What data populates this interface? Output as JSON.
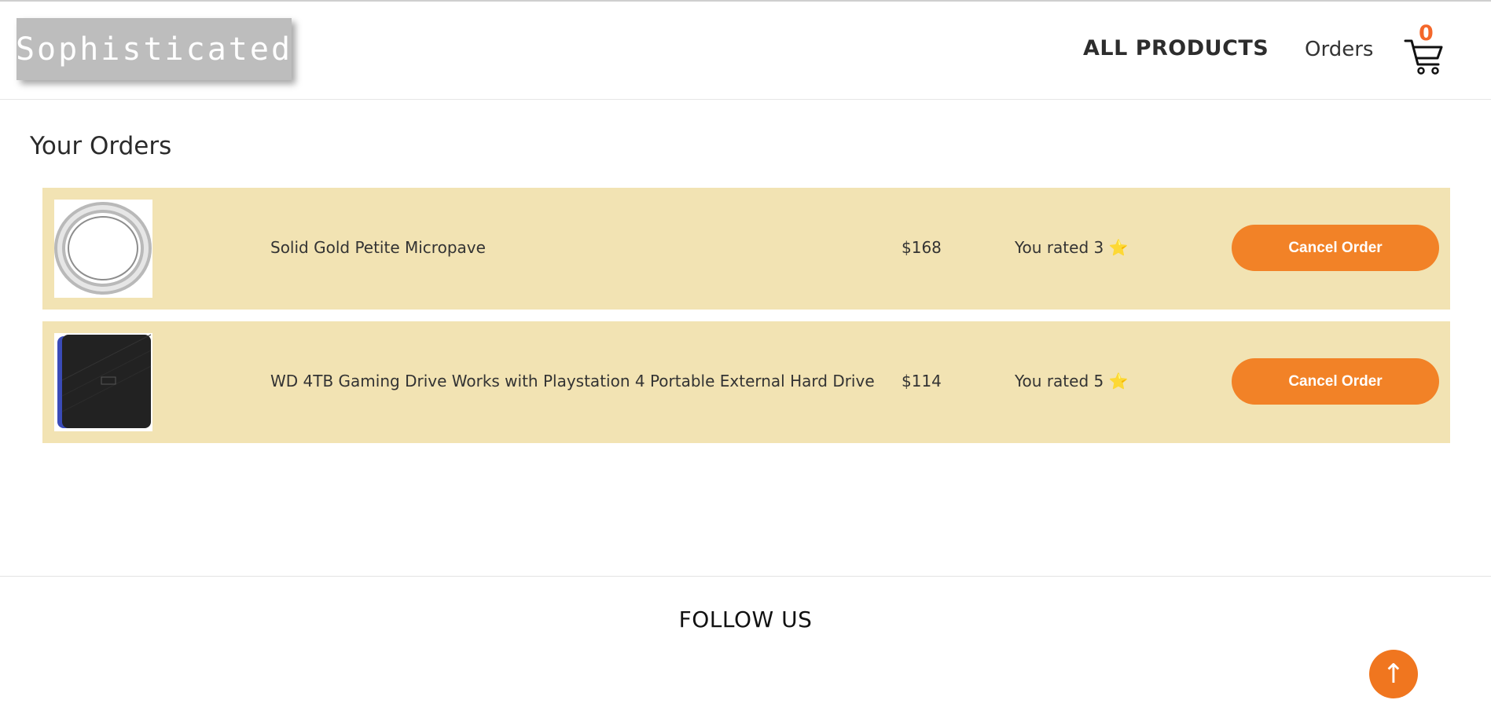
{
  "header": {
    "logo": "Sophisticated",
    "nav": {
      "all_products": "ALL PRODUCTS",
      "orders": "Orders"
    },
    "cart": {
      "icon": "cart-icon",
      "count": "0"
    }
  },
  "page": {
    "title": "Your Orders"
  },
  "orders": [
    {
      "name": "Solid Gold Petite Micropave",
      "price": "$168",
      "rating_text": "You rated 3",
      "star": "⭐",
      "cancel_label": "Cancel Order",
      "image": "ring-image"
    },
    {
      "name": "WD 4TB Gaming Drive Works with Playstation 4 Portable External Hard Drive",
      "price": "$114",
      "rating_text": "You rated 5",
      "star": "⭐",
      "cancel_label": "Cancel Order",
      "image": "hard-drive-image"
    }
  ],
  "footer": {
    "follow": "FOLLOW US",
    "to_top": "↑"
  },
  "colors": {
    "accent": "#f28227",
    "row_bg": "#f2e3b3",
    "cart_count": "#f4672a",
    "star": "#f6c21b"
  }
}
